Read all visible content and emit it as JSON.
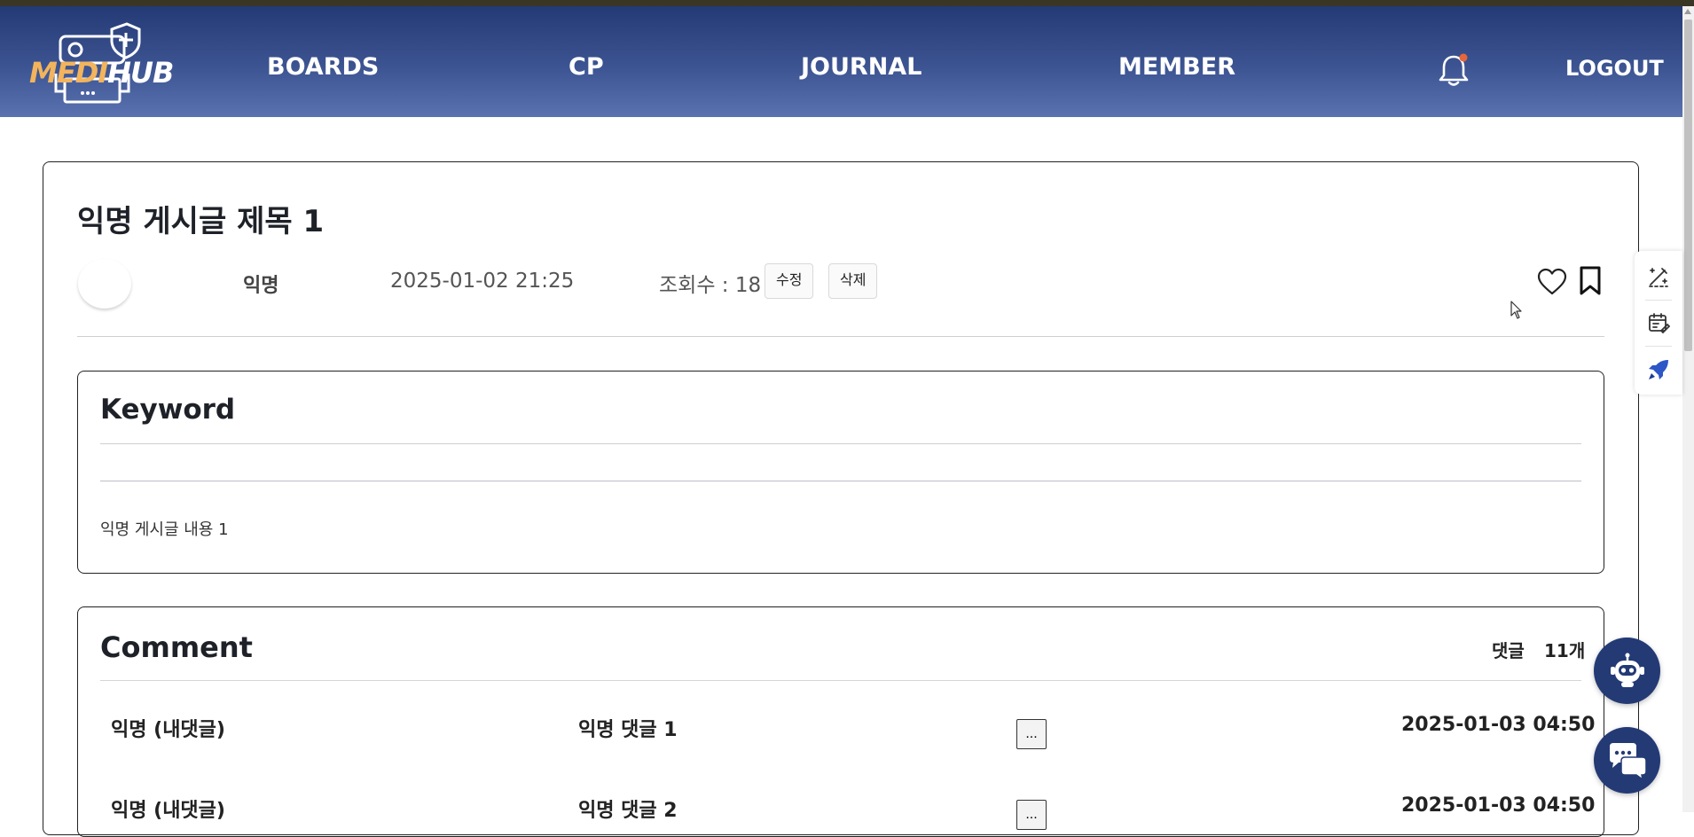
{
  "app": {
    "logo_text_part1": "MEDI",
    "logo_text_part2": "HUB"
  },
  "nav": {
    "items": [
      {
        "label": "BOARDS"
      },
      {
        "label": "CP"
      },
      {
        "label": "JOURNAL"
      },
      {
        "label": "MEMBER"
      }
    ],
    "logout_label": "LOGOUT",
    "notification_icon": "bell-icon",
    "has_unread_notification": true
  },
  "post": {
    "title": "익명 게시글 제목 1",
    "author": "익명",
    "date": "2025-01-02 21:25",
    "views_label": "조회수 : 18",
    "edit_label": "수정",
    "delete_label": "삭제",
    "like_icon": "heart-icon",
    "bookmark_icon": "bookmark-icon"
  },
  "keyword": {
    "title": "Keyword",
    "body": "익명 게시글 내용 1"
  },
  "comments": {
    "title": "Comment",
    "count_label": "댓글",
    "count_value": "11개",
    "items": [
      {
        "author": "익명 (내댓글)",
        "text": "익명 댓글 1",
        "more": "...",
        "date": "2025-01-03 04:50"
      },
      {
        "author": "익명 (내댓글)",
        "text": "익명 댓글 2",
        "more": "...",
        "date": "2025-01-03 04:50"
      }
    ]
  },
  "side_tools": [
    "edit-wand-icon",
    "calendar-edit-icon",
    "rocket-icon"
  ],
  "floating_buttons": [
    "robot-chatbot-icon",
    "chat-bubbles-icon"
  ],
  "colors": {
    "header_top": "#233a75",
    "header_bottom": "#5a72b0",
    "logo_accent": "#f2b45c",
    "notification_dot": "#e8663a",
    "fab_bg": "#233a75"
  }
}
